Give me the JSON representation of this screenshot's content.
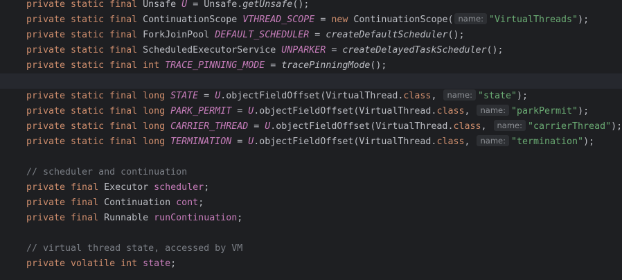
{
  "editor": {
    "lines": [
      {
        "kind": "code",
        "tokens": [
          {
            "t": "kw",
            "v": "private static final "
          },
          {
            "t": "ty",
            "v": "Unsafe "
          },
          {
            "t": "sfield",
            "v": "U"
          },
          {
            "t": "plain",
            "v": " = Unsafe."
          },
          {
            "t": "smeth",
            "v": "getUnsafe"
          },
          {
            "t": "plain",
            "v": "();"
          }
        ]
      },
      {
        "kind": "code",
        "tokens": [
          {
            "t": "kw",
            "v": "private static final "
          },
          {
            "t": "ty",
            "v": "ContinuationScope "
          },
          {
            "t": "sfield",
            "v": "VTHREAD_SCOPE"
          },
          {
            "t": "plain",
            "v": " = "
          },
          {
            "t": "kw",
            "v": "new "
          },
          {
            "t": "plain",
            "v": "ContinuationScope("
          },
          {
            "t": "hint",
            "v": "name:"
          },
          {
            "t": "str",
            "v": "\"VirtualThreads\""
          },
          {
            "t": "plain",
            "v": ");"
          }
        ]
      },
      {
        "kind": "code",
        "tokens": [
          {
            "t": "kw",
            "v": "private static final "
          },
          {
            "t": "ty",
            "v": "ForkJoinPool "
          },
          {
            "t": "sfield",
            "v": "DEFAULT_SCHEDULER"
          },
          {
            "t": "plain",
            "v": " = "
          },
          {
            "t": "smeth",
            "v": "createDefaultScheduler"
          },
          {
            "t": "plain",
            "v": "();"
          }
        ]
      },
      {
        "kind": "code",
        "tokens": [
          {
            "t": "kw",
            "v": "private static final "
          },
          {
            "t": "ty",
            "v": "ScheduledExecutorService "
          },
          {
            "t": "sfield",
            "v": "UNPARKER"
          },
          {
            "t": "plain",
            "v": " = "
          },
          {
            "t": "smeth",
            "v": "createDelayedTaskScheduler"
          },
          {
            "t": "plain",
            "v": "();"
          }
        ]
      },
      {
        "kind": "code",
        "tokens": [
          {
            "t": "kw",
            "v": "private static final int "
          },
          {
            "t": "sfield",
            "v": "TRACE_PINNING_MODE"
          },
          {
            "t": "plain",
            "v": " = "
          },
          {
            "t": "smeth",
            "v": "tracePinningMode"
          },
          {
            "t": "plain",
            "v": "();"
          }
        ]
      },
      {
        "kind": "current",
        "tokens": []
      },
      {
        "kind": "code",
        "tokens": [
          {
            "t": "kw",
            "v": "private static final long "
          },
          {
            "t": "sfield",
            "v": "STATE"
          },
          {
            "t": "plain",
            "v": " = "
          },
          {
            "t": "sfield",
            "v": "U"
          },
          {
            "t": "plain",
            "v": ".objectFieldOffset(VirtualThread."
          },
          {
            "t": "kw",
            "v": "class"
          },
          {
            "t": "plain",
            "v": ", "
          },
          {
            "t": "hint",
            "v": "name:"
          },
          {
            "t": "str",
            "v": "\"state\""
          },
          {
            "t": "plain",
            "v": ");"
          }
        ]
      },
      {
        "kind": "code",
        "tokens": [
          {
            "t": "kw",
            "v": "private static final long "
          },
          {
            "t": "sfield",
            "v": "PARK_PERMIT"
          },
          {
            "t": "plain",
            "v": " = "
          },
          {
            "t": "sfield",
            "v": "U"
          },
          {
            "t": "plain",
            "v": ".objectFieldOffset(VirtualThread."
          },
          {
            "t": "kw",
            "v": "class"
          },
          {
            "t": "plain",
            "v": ", "
          },
          {
            "t": "hint",
            "v": "name:"
          },
          {
            "t": "str",
            "v": "\"parkPermit\""
          },
          {
            "t": "plain",
            "v": ");"
          }
        ]
      },
      {
        "kind": "code",
        "tokens": [
          {
            "t": "kw",
            "v": "private static final long "
          },
          {
            "t": "sfield",
            "v": "CARRIER_THREAD"
          },
          {
            "t": "plain",
            "v": " = "
          },
          {
            "t": "sfield",
            "v": "U"
          },
          {
            "t": "plain",
            "v": ".objectFieldOffset(VirtualThread."
          },
          {
            "t": "kw",
            "v": "class"
          },
          {
            "t": "plain",
            "v": ", "
          },
          {
            "t": "hint",
            "v": "name:"
          },
          {
            "t": "str",
            "v": "\"carrierThread\""
          },
          {
            "t": "plain",
            "v": ");"
          }
        ]
      },
      {
        "kind": "code",
        "tokens": [
          {
            "t": "kw",
            "v": "private static final long "
          },
          {
            "t": "sfield",
            "v": "TERMINATION"
          },
          {
            "t": "plain",
            "v": " = "
          },
          {
            "t": "sfield",
            "v": "U"
          },
          {
            "t": "plain",
            "v": ".objectFieldOffset(VirtualThread."
          },
          {
            "t": "kw",
            "v": "class"
          },
          {
            "t": "plain",
            "v": ", "
          },
          {
            "t": "hint",
            "v": "name:"
          },
          {
            "t": "str",
            "v": "\"termination\""
          },
          {
            "t": "plain",
            "v": ");"
          }
        ]
      },
      {
        "kind": "blank",
        "tokens": []
      },
      {
        "kind": "code",
        "tokens": [
          {
            "t": "cmt",
            "v": "// scheduler and continuation"
          }
        ]
      },
      {
        "kind": "code",
        "tokens": [
          {
            "t": "kw",
            "v": "private final "
          },
          {
            "t": "ty",
            "v": "Executor "
          },
          {
            "t": "field",
            "v": "scheduler"
          },
          {
            "t": "plain",
            "v": ";"
          }
        ]
      },
      {
        "kind": "code",
        "tokens": [
          {
            "t": "kw",
            "v": "private final "
          },
          {
            "t": "ty",
            "v": "Continuation "
          },
          {
            "t": "field",
            "v": "cont"
          },
          {
            "t": "plain",
            "v": ";"
          }
        ]
      },
      {
        "kind": "code",
        "tokens": [
          {
            "t": "kw",
            "v": "private final "
          },
          {
            "t": "ty",
            "v": "Runnable "
          },
          {
            "t": "field",
            "v": "runContinuation"
          },
          {
            "t": "plain",
            "v": ";"
          }
        ]
      },
      {
        "kind": "blank",
        "tokens": []
      },
      {
        "kind": "code",
        "tokens": [
          {
            "t": "cmt",
            "v": "// virtual thread state, accessed by VM"
          }
        ]
      },
      {
        "kind": "code",
        "tokens": [
          {
            "t": "kw",
            "v": "private volatile int "
          },
          {
            "t": "field",
            "v": "state"
          },
          {
            "t": "plain",
            "v": ";"
          }
        ]
      }
    ]
  },
  "colors": {
    "background": "#1e1f22",
    "current_line": "#26282e",
    "keyword": "#cf8e6d",
    "field": "#c77dbb",
    "string": "#6aab73",
    "comment": "#7a7e85",
    "text": "#bcbec4",
    "hint_bg": "#2d2f33",
    "hint_fg": "#8c8f94"
  }
}
